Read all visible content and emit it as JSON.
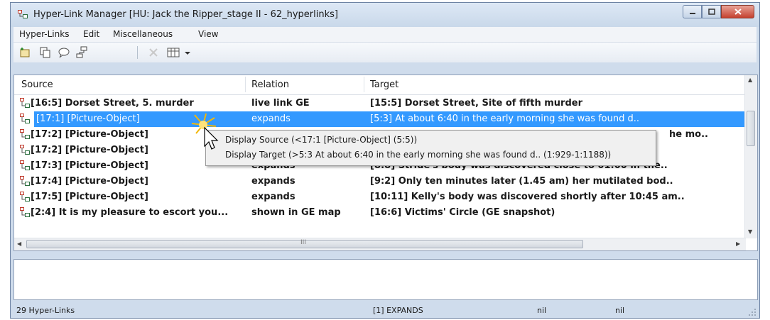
{
  "window": {
    "title": "Hyper-Link Manager [HU: Jack the Ripper_stage II - 62_hyperlinks]"
  },
  "menu": [
    "Hyper-Links",
    "Edit",
    "Miscellaneous",
    "View"
  ],
  "toolbar": {
    "icons": [
      "new-link-icon",
      "copy-icon",
      "comment-icon",
      "tree-icon",
      "delete-icon",
      "columns-icon",
      "dropdown-icon"
    ]
  },
  "table": {
    "headers": [
      "Source",
      "Relation",
      "Target"
    ],
    "rows": [
      {
        "source": "[16:5] Dorset Street, 5. murder",
        "relation": "live link GE",
        "target": "[15:5] Dorset Street, Site of fifth murder"
      },
      {
        "source": "[17:1] [Picture-Object]",
        "relation": "expands",
        "target": "[5:3] At about 6:40 in the early morning she was found d.."
      },
      {
        "source": "[17:2] [Picture-Object]",
        "relation": "",
        "target": "he mo.."
      },
      {
        "source": "[17:2] [Picture-Object]",
        "relation": "",
        "target": ""
      },
      {
        "source": "[17:3] [Picture-Object]",
        "relation": "expands",
        "target": "[8:8] Stride's body was discovered close to 01:00 in the.."
      },
      {
        "source": "[17:4] [Picture-Object]",
        "relation": "expands",
        "target": "[9:2] Only ten minutes later (1.45 am) her mutilated bod.."
      },
      {
        "source": "[17:5] [Picture-Object]",
        "relation": "expands",
        "target": "[10:11] Kelly's body was discovered shortly after 10:45 am.."
      },
      {
        "source": "[2:4] It is my pleasure to escort you...",
        "relation": "shown in GE map",
        "target": "[16:6] Victims' Circle (GE snapshot)"
      }
    ],
    "hscroll_mid": "III"
  },
  "context_popup": {
    "source_line": "Display Source (<17:1 [Picture-Object] (5:5))",
    "target_line": "Display Target (>5:3 At about 6:40 in the early morning she was found d.. (1:929-1:1188))"
  },
  "status": {
    "count": "29 Hyper-Links",
    "relation": "[1] EXPANDS",
    "field1": "nil",
    "field2": "nil"
  },
  "colors": {
    "selection": "#3399ff",
    "frame": "#cfdcec"
  }
}
